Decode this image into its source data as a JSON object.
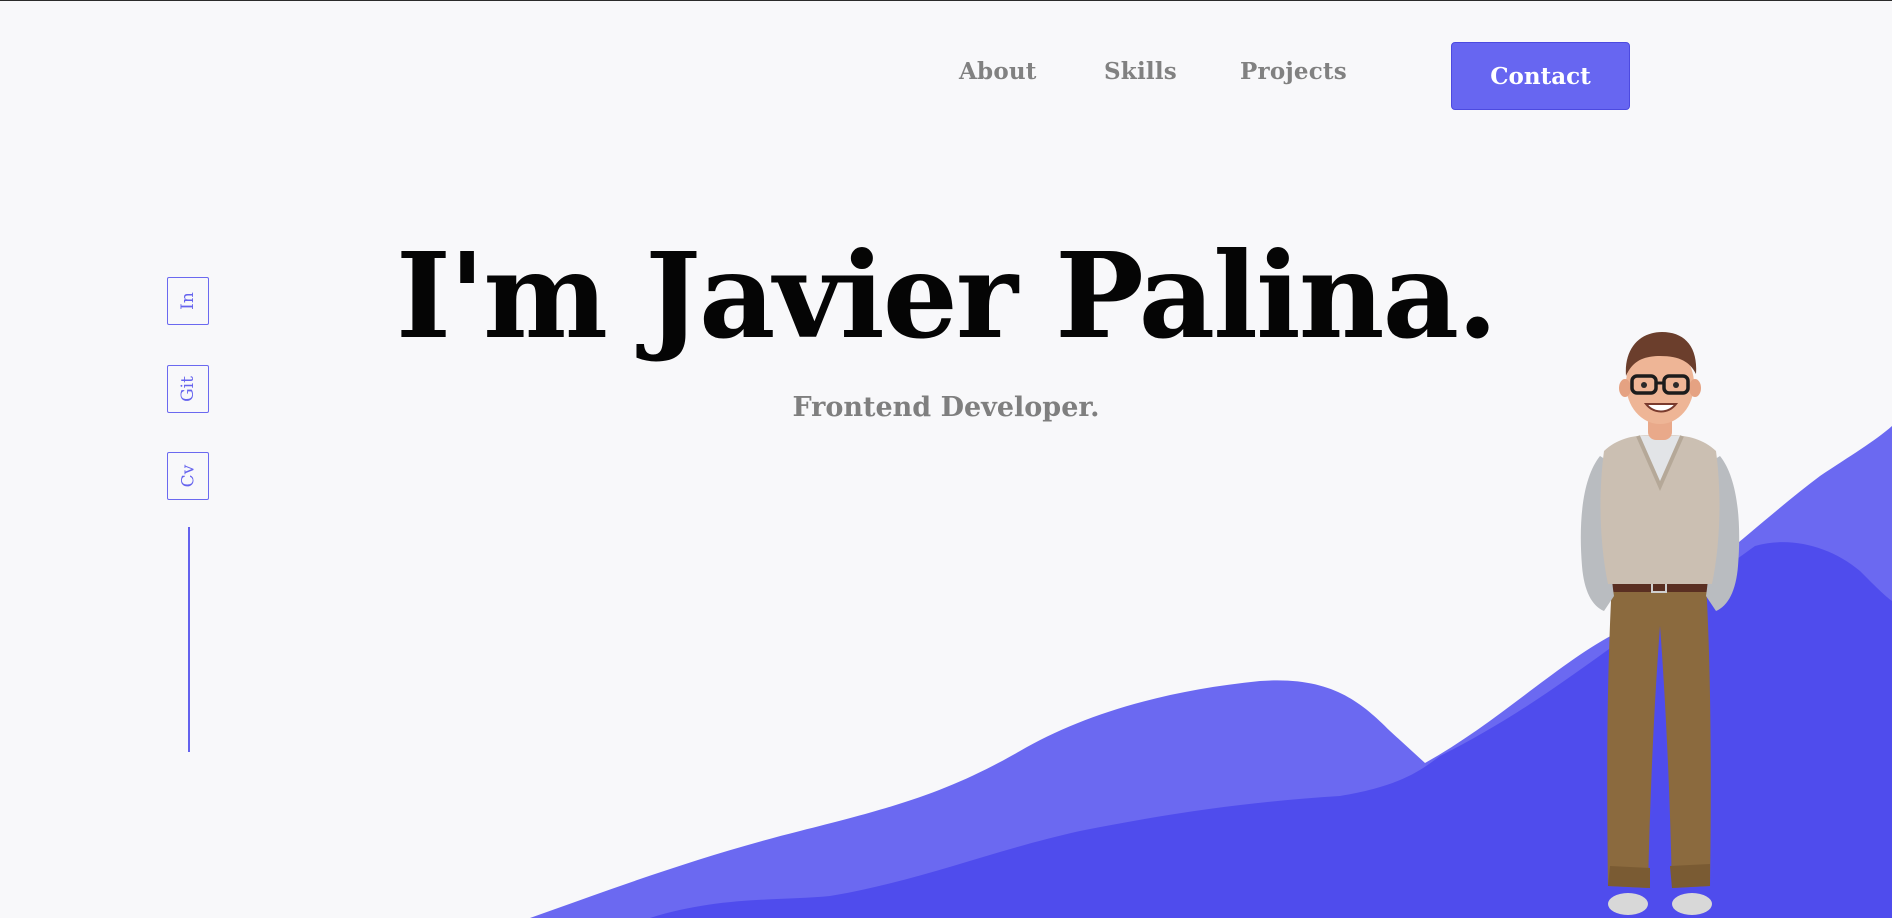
{
  "nav": {
    "links": [
      {
        "label": "About"
      },
      {
        "label": "Skills"
      },
      {
        "label": "Projects"
      }
    ],
    "contact_label": "Contact"
  },
  "social": {
    "items": [
      {
        "label": "In",
        "icon": "linkedin"
      },
      {
        "label": "Git",
        "icon": "github"
      },
      {
        "label": "Cv",
        "icon": "resume"
      }
    ]
  },
  "hero": {
    "title": "I'm Javier Palina.",
    "subtitle": "Frontend Developer."
  },
  "colors": {
    "accent": "#6766f1",
    "wave_light": "#6b69f1",
    "wave_dark": "#4f4ced",
    "background": "#f8f8fa",
    "title": "#050505",
    "muted": "#818181"
  }
}
